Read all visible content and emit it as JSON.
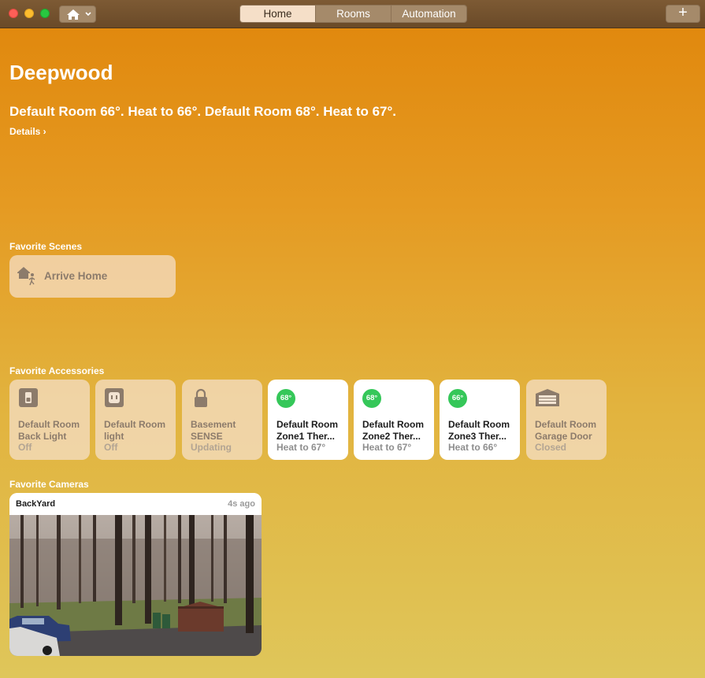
{
  "toolbar": {
    "tabs": [
      {
        "label": "Home",
        "active": true
      },
      {
        "label": "Rooms",
        "active": false
      },
      {
        "label": "Automation",
        "active": false
      }
    ],
    "add_label": "+"
  },
  "home": {
    "title": "Deepwood",
    "status": "Default Room 66°. Heat to 66°. Default Room 68°. Heat to 67°.",
    "details_label": "Details ›"
  },
  "scenes": {
    "label": "Favorite Scenes",
    "items": [
      {
        "name": "Arrive Home",
        "icon": "arrive-home-icon"
      }
    ]
  },
  "accessories": {
    "label": "Favorite Accessories",
    "items": [
      {
        "line1": "Default Room",
        "line2": "Back Light",
        "status": "Off",
        "icon": "light-switch-icon",
        "state": "off"
      },
      {
        "line1": "Default Room",
        "line2": "light",
        "status": "Off",
        "icon": "outlet-icon",
        "state": "off"
      },
      {
        "line1": "Basement",
        "line2": "SENSE",
        "status": "Updating",
        "icon": "lock-icon",
        "state": "off"
      },
      {
        "line1": "Default Room",
        "line2": "Zone1 Ther...",
        "status": "Heat to 67°",
        "badge": "68°",
        "icon": "thermostat-icon",
        "state": "on"
      },
      {
        "line1": "Default Room",
        "line2": "Zone2 Ther...",
        "status": "Heat to 67°",
        "badge": "68°",
        "icon": "thermostat-icon",
        "state": "on"
      },
      {
        "line1": "Default Room",
        "line2": "Zone3 Ther...",
        "status": "Heat to 66°",
        "badge": "66°",
        "icon": "thermostat-icon",
        "state": "on"
      },
      {
        "line1": "Default Room",
        "line2": "Garage Door",
        "status": "Closed",
        "icon": "garage-door-icon",
        "state": "off"
      }
    ]
  },
  "cameras": {
    "label": "Favorite Cameras",
    "items": [
      {
        "name": "BackYard",
        "time": "4s ago"
      }
    ]
  },
  "colors": {
    "accent_green": "#35c759",
    "toolbar": "#7d5a34",
    "background_top": "#e0860b",
    "background_bottom": "#dfc65a"
  }
}
